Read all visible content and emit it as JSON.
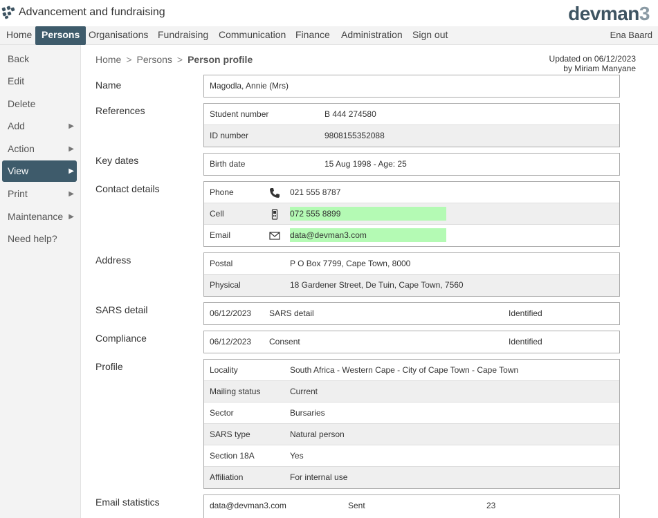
{
  "app": {
    "title": "Advancement and fundraising",
    "brand_main": "devman",
    "brand_suffix": "3"
  },
  "topnav": {
    "items": [
      "Home",
      "Persons",
      "Organisations",
      "Fundraising",
      "Communication",
      "Finance",
      "Administration",
      "Sign out"
    ],
    "active": "Persons",
    "user": "Ena Baard"
  },
  "sidebar": {
    "items": [
      {
        "label": "Back",
        "arrow": ""
      },
      {
        "label": "Edit",
        "arrow": ""
      },
      {
        "label": "Delete",
        "arrow": ""
      },
      {
        "label": "Add",
        "arrow": "▶"
      },
      {
        "label": "Action",
        "arrow": "▶"
      },
      {
        "label": "View",
        "arrow": "▶"
      },
      {
        "label": "Print",
        "arrow": "▶"
      },
      {
        "label": "Maintenance",
        "arrow": "▶"
      },
      {
        "label": "Need help?",
        "arrow": ""
      }
    ],
    "active": "View"
  },
  "breadcrumb": {
    "home": "Home",
    "persons": "Persons",
    "current": "Person profile",
    "sep": ">"
  },
  "updated": {
    "line1": "Updated on 06/12/2023",
    "line2": "by Miriam Manyane"
  },
  "sections": {
    "name": {
      "label": "Name",
      "value": "Magodla, Annie (Mrs)"
    },
    "references": {
      "label": "References",
      "rows": [
        {
          "key": "Student number",
          "value": "B 444 274580"
        },
        {
          "key": "ID number",
          "value": "9808155352088"
        }
      ]
    },
    "key_dates": {
      "label": "Key dates",
      "rows": [
        {
          "key": "Birth date",
          "value": "15 Aug 1998 - Age: 25"
        }
      ]
    },
    "contact": {
      "label": "Contact details",
      "rows": [
        {
          "key": "Phone",
          "icon": "phone-icon",
          "value": "021 555 8787"
        },
        {
          "key": "Cell",
          "icon": "mobile-icon",
          "value": "072 555 8899"
        },
        {
          "key": "Email",
          "icon": "envelope-icon",
          "value": "data@devman3.com"
        }
      ],
      "highlight_color": "#b4fab4"
    },
    "address": {
      "label": "Address",
      "rows": [
        {
          "key": "Postal",
          "value": "P O Box 7799, Cape Town, 8000"
        },
        {
          "key": "Physical",
          "value": "18 Gardener Street, De Tuin, Cape Town, 7560"
        }
      ]
    },
    "sars": {
      "label": "SARS detail",
      "date": "06/12/2023",
      "type": "SARS detail",
      "status": "Identified"
    },
    "compliance": {
      "label": "Compliance",
      "date": "06/12/2023",
      "type": "Consent",
      "status": "Identified"
    },
    "profile": {
      "label": "Profile",
      "rows": [
        {
          "key": "Locality",
          "value": "South Africa - Western Cape - City of Cape Town - Cape Town"
        },
        {
          "key": "Mailing status",
          "value": "Current"
        },
        {
          "key": "Sector",
          "value": "Bursaries"
        },
        {
          "key": "SARS type",
          "value": "Natural person"
        },
        {
          "key": "Section 18A",
          "value": "Yes"
        },
        {
          "key": "Affiliation",
          "value": "For internal use"
        }
      ]
    },
    "email_stats": {
      "label": "Email statistics",
      "email": "data@devman3.com",
      "metric": "Sent",
      "count": "23"
    }
  },
  "colors": {
    "nav_active": "#3e5b6b",
    "brand": "#3e5462",
    "highlight": "#b4fab4"
  }
}
